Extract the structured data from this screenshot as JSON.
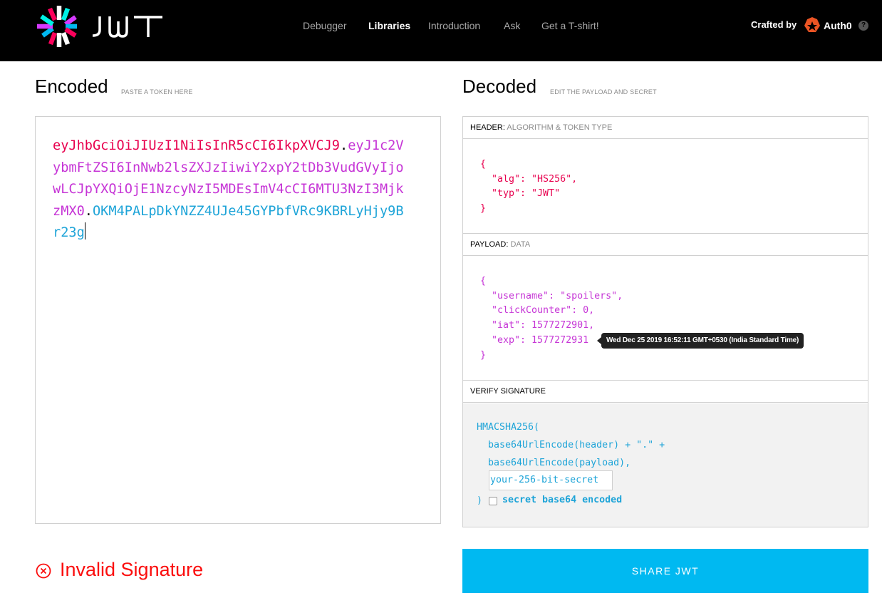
{
  "brand": {
    "logo_text": "JWT",
    "logo_icon": "jwt-flower-icon"
  },
  "nav": {
    "items": [
      {
        "label": "Debugger",
        "active": false
      },
      {
        "label": "Libraries",
        "active": true
      },
      {
        "label": "Introduction",
        "active": false
      },
      {
        "label": "Ask",
        "active": false
      },
      {
        "label": "Get a T-shirt!",
        "active": false
      }
    ]
  },
  "crafted_by": {
    "label": "Crafted by",
    "company": "Auth0",
    "help": "?"
  },
  "encoded": {
    "title": "Encoded",
    "subtitle": "PASTE A TOKEN HERE",
    "token_header": "eyJhbGciOiJIUzI1NiIsInR5cCI6IkpXVCJ9",
    "token_payload": "eyJ1c2VybmFtZSI6InNwb2lsZXJzIiwiY2xpY2tDb3VudGVyIjowLCJpYXQiOjE1NzcyNzI5MDEsImV4cCI6MTU3NzI3MjkzMX0",
    "token_signature": "OKM4PALpDkYNZZ4UJe45GYPbfVRc9KBRLyHjy9Br23g",
    "dot": "."
  },
  "decoded": {
    "title": "Decoded",
    "subtitle": "EDIT THE PAYLOAD AND SECRET",
    "header_section": {
      "label": "HEADER:",
      "sub": "ALGORITHM & TOKEN TYPE"
    },
    "header_json": "{\n  \"alg\": \"HS256\",\n  \"typ\": \"JWT\"\n}",
    "payload_section": {
      "label": "PAYLOAD:",
      "sub": "DATA"
    },
    "payload_json": "{\n  \"username\": \"spoilers\",\n  \"clickCounter\": 0,\n  \"iat\": 1577272901,\n  \"exp\": 1577272931\n}",
    "exp_tooltip": "Wed Dec 25 2019 16:52:11 GMT+0530 (India Standard Time)",
    "verify_section": {
      "label": "VERIFY SIGNATURE"
    },
    "verify": {
      "line1": "HMACSHA256(",
      "line2": "  base64UrlEncode(header) + \".\" +",
      "line3": "  base64UrlEncode(payload),",
      "secret_placeholder": "your-256-bit-secret",
      "closing": ")",
      "checkbox_label": "secret base64 encoded",
      "checkbox_checked": false
    }
  },
  "status": {
    "text": "Invalid Signature",
    "color": "#fb0e0e"
  },
  "share_button": "SHARE JWT",
  "colors": {
    "header": "#e8004e",
    "payload": "#c635d6",
    "signature": "#1ea4d8",
    "share": "#00b9f1"
  }
}
